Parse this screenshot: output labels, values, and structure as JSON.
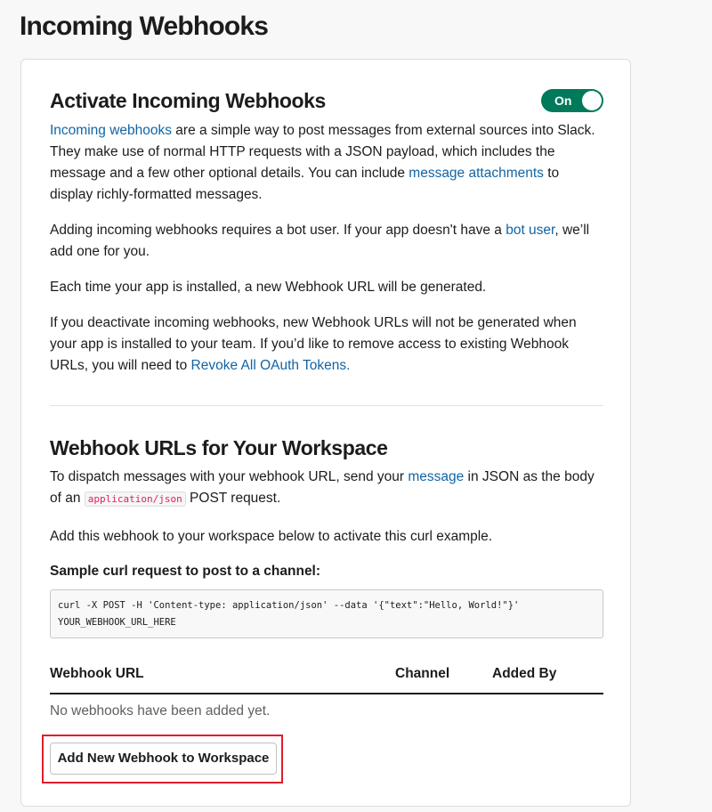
{
  "page": {
    "title": "Incoming Webhooks"
  },
  "activate": {
    "title": "Activate Incoming Webhooks",
    "toggle_label": "On",
    "toggle_on": true,
    "p1": {
      "link1": "Incoming webhooks",
      "text1": " are a simple way to post messages from external sources into Slack. They make use of normal HTTP requests with a JSON payload, which includes the message and a few other optional details. You can include ",
      "link2": "message attachments",
      "text2": " to display richly-formatted messages."
    },
    "p2": {
      "text1": "Adding incoming webhooks requires a bot user. If your app doesn't have a ",
      "link1": "bot user",
      "text2": ", we’ll add one for you."
    },
    "p3": "Each time your app is installed, a new Webhook URL will be generated.",
    "p4": {
      "text1": "If you deactivate incoming webhooks, new Webhook URLs will not be generated when your app is installed to your team. If you’d like to remove access to existing Webhook URLs, you will need to ",
      "link1": "Revoke All OAuth Tokens."
    }
  },
  "workspace": {
    "title": "Webhook URLs for Your Workspace",
    "p1": {
      "text1": "To dispatch messages with your webhook URL, send your ",
      "link1": "message",
      "text2": " in JSON as the body of an ",
      "code": "application/json",
      "text3": " POST request."
    },
    "p2": "Add this webhook to your workspace below to activate this curl example.",
    "sample_label": "Sample curl request to post to a channel:",
    "code_line1": "curl -X POST -H 'Content-type: application/json' --data '{\"text\":\"Hello, World!\"}'",
    "code_line2": "YOUR_WEBHOOK_URL_HERE",
    "table": {
      "columns": [
        "Webhook URL",
        "Channel",
        "Added By"
      ],
      "empty_message": "No webhooks have been added yet."
    },
    "add_button_label": "Add New Webhook to Workspace"
  },
  "colors": {
    "toggle_on": "#007a5a",
    "link": "#1264a3",
    "highlight": "#e01e2c",
    "inline_code": "#e01e5a"
  }
}
